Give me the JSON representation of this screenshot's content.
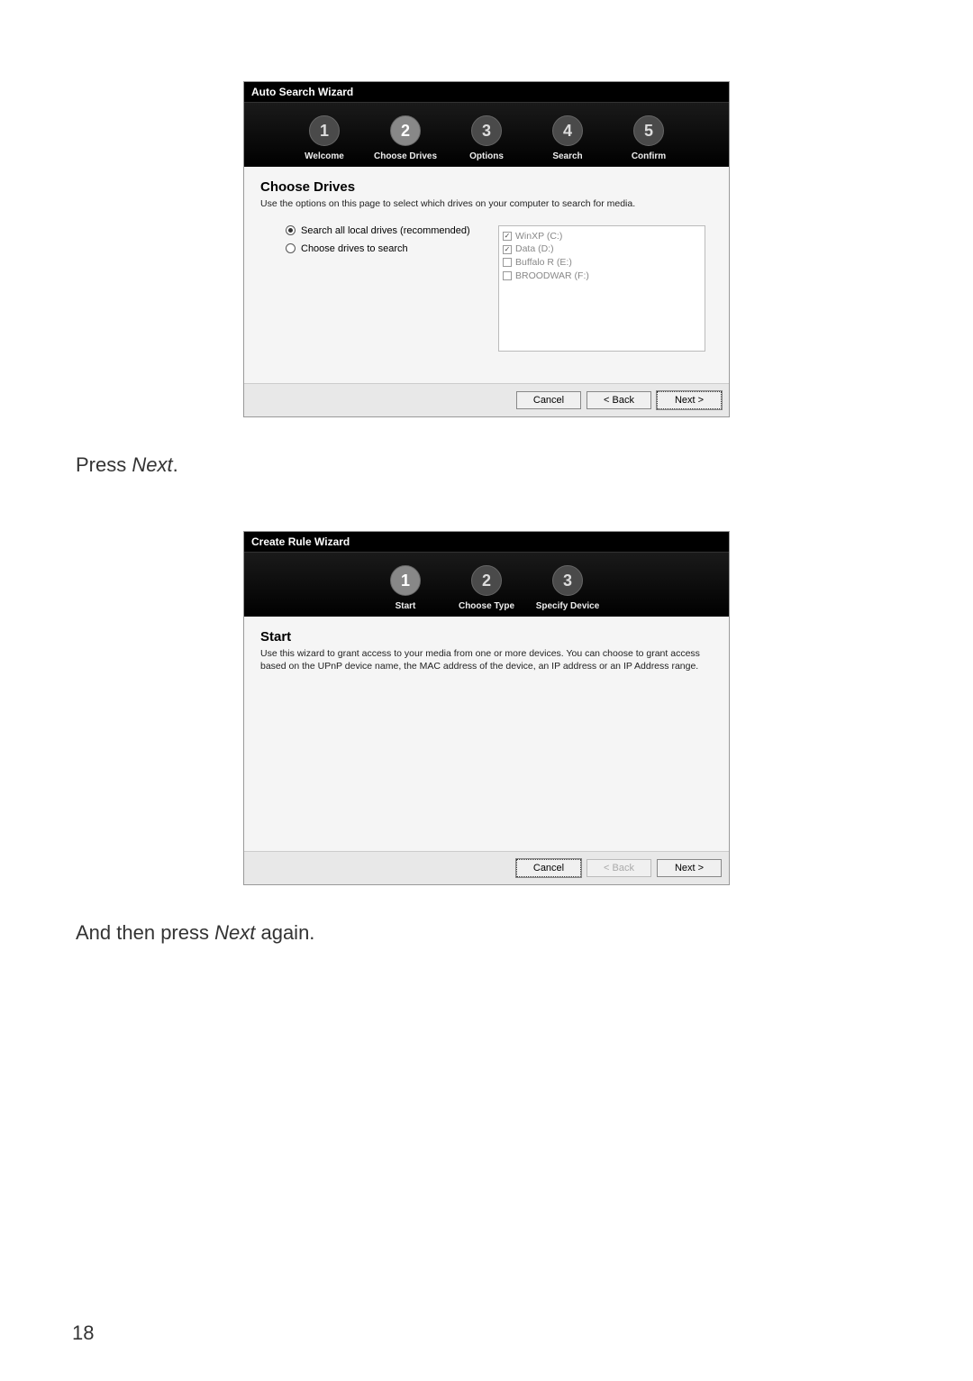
{
  "wizard1": {
    "title": "Auto Search Wizard",
    "steps": [
      {
        "num": "1",
        "label": "Welcome"
      },
      {
        "num": "2",
        "label": "Choose Drives"
      },
      {
        "num": "3",
        "label": "Options"
      },
      {
        "num": "4",
        "label": "Search"
      },
      {
        "num": "5",
        "label": "Confirm"
      }
    ],
    "section_title": "Choose Drives",
    "section_desc": "Use the options on this page to select which drives on your computer to search for media.",
    "radio1": "Search all local drives (recommended)",
    "radio2": "Choose drives to search",
    "drives": [
      {
        "label": "WinXP (C:)",
        "checked": true
      },
      {
        "label": "Data (D:)",
        "checked": true
      },
      {
        "label": "Buffalo R (E:)",
        "checked": false
      },
      {
        "label": "BROODWAR (F:)",
        "checked": false
      }
    ],
    "btn_cancel": "Cancel",
    "btn_back": "< Back",
    "btn_next": "Next >"
  },
  "caption1_a": "Press ",
  "caption1_b": "Next",
  "caption1_c": ".",
  "wizard2": {
    "title": "Create Rule Wizard",
    "steps": [
      {
        "num": "1",
        "label": "Start"
      },
      {
        "num": "2",
        "label": "Choose Type"
      },
      {
        "num": "3",
        "label": "Specify Device"
      }
    ],
    "section_title": "Start",
    "section_desc": "Use this wizard to grant access to your media from one or more devices. You can choose to grant access based on the UPnP device name, the MAC address of the device, an IP address or an IP Address range.",
    "btn_cancel": "Cancel",
    "btn_back": "< Back",
    "btn_next": "Next >"
  },
  "caption2_a": "And then press ",
  "caption2_b": "Next",
  "caption2_c": " again.",
  "page_number": "18"
}
